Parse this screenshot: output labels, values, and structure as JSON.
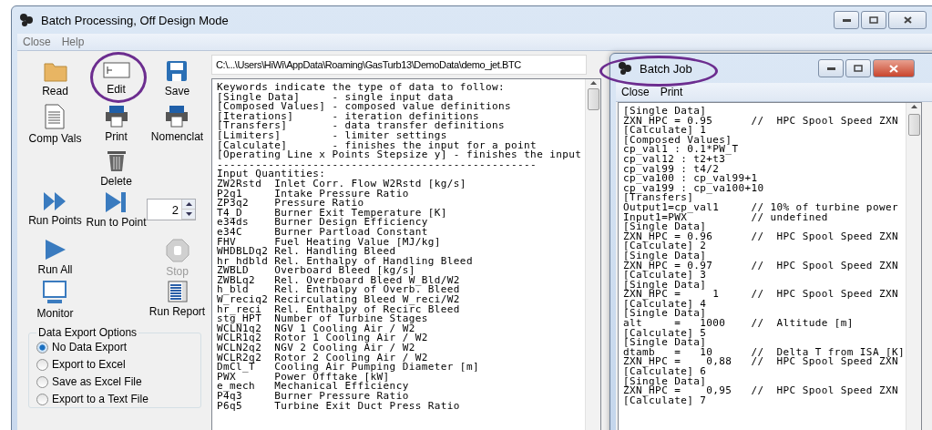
{
  "main_window": {
    "title": "Batch Processing, Off Design Mode",
    "menu": [
      "Close",
      "Help"
    ]
  },
  "toolbar": {
    "rows": [
      [
        {
          "kind": "button",
          "label": "Read",
          "highlighted": false,
          "disabled": false
        },
        {
          "kind": "button",
          "label": "Edit",
          "highlighted": true,
          "disabled": false
        },
        {
          "kind": "button",
          "label": "Save",
          "highlighted": false,
          "disabled": false
        }
      ],
      [
        {
          "kind": "button",
          "label": "Comp Vals",
          "highlighted": false,
          "disabled": false
        },
        {
          "kind": "button",
          "label": "Print",
          "highlighted": false,
          "disabled": false
        },
        {
          "kind": "button",
          "label": "Nomenclat",
          "highlighted": false,
          "disabled": false
        }
      ],
      [
        {
          "kind": "spacer"
        },
        {
          "kind": "button",
          "label": "Delete",
          "highlighted": false,
          "disabled": false
        },
        {
          "kind": "spacer"
        }
      ],
      [
        {
          "kind": "button",
          "label": "Run Points",
          "highlighted": false,
          "disabled": false
        },
        {
          "kind": "button",
          "label": "Run to Point",
          "highlighted": false,
          "disabled": false
        },
        {
          "kind": "spinner",
          "value": "2"
        }
      ],
      [
        {
          "kind": "button",
          "label": "Run All",
          "highlighted": false,
          "disabled": false
        },
        {
          "kind": "spacer"
        },
        {
          "kind": "button",
          "label": "Stop",
          "highlighted": false,
          "disabled": true
        }
      ],
      [
        {
          "kind": "button",
          "label": "Monitor",
          "highlighted": false,
          "disabled": false
        },
        {
          "kind": "spacer"
        },
        {
          "kind": "button",
          "label": "Run Report",
          "highlighted": false,
          "disabled": false
        }
      ]
    ]
  },
  "export_options": {
    "title": "Data Export Options",
    "options": [
      {
        "label": "No Data Export",
        "selected": true
      },
      {
        "label": "Export to Excel",
        "selected": false
      },
      {
        "label": "Save as Excel File",
        "selected": false
      },
      {
        "label": "Export to a Text File",
        "selected": false
      }
    ]
  },
  "file_path": "C:\\...\\Users\\HiWi\\AppData\\Roaming\\GasTurb13\\DemoData\\demo_jet.BTC",
  "editor_lines": [
    "Keywords indicate the type of data to follow:",
    "[Single Data]     - single input data",
    "[Composed Values] - composed value definitions",
    "[Iterations]      - iteration definitions",
    "[Transfers]       - data transfer definitions",
    "[Limiters]        - limiter settings",
    "[Calculate]       - finishes the input for a point",
    "[Operating Line x Points Stepsize y] - finishes the input",
    "--------------------------------------------------",
    "Input Quantities:",
    "ZW2Rstd  Inlet Corr. Flow W2Rstd [kg/s]",
    "P2q1     Intake Pressure Ratio",
    "ZP3q2    Pressure Ratio",
    "T4_D     Burner Exit Temperature [K]",
    "e34ds    Burner Design Efficiency",
    "e34C     Burner Partload Constant",
    "FHV      Fuel Heating Value [MJ/kg]",
    "WHDBLDq2 Rel. Handling Bleed",
    "hr_hdbld Rel. Enthalpy of Handling Bleed",
    "ZWBLD    Overboard Bleed [kg/s]",
    "ZWBLq2   Rel. Overboard Bleed W_Bld/W2",
    "h_bld    Rel. Enthalpy of Overb. Bleed",
    "W_reciq2 Recirculating Bleed W_reci/W2",
    "hr_reci  Rel. Enthalpy of Recirc Bleed",
    "stg_HPT  Number of Turbine Stages",
    "WCLN1q2  NGV 1 Cooling Air / W2",
    "WCLR1q2  Rotor 1 Cooling Air / W2",
    "WCLN2q2  NGV 2 Cooling Air / W2",
    "WCLR2q2  Rotor 2 Cooling Air / W2",
    "DmCl_T   Cooling Air Pumping Diameter [m]",
    "PWX      Power Offtake [kW]",
    "e_mech   Mechanical Efficiency",
    "P4q3     Burner Pressure Ratio",
    "P6q5     Turbine Exit Duct Press Ratio"
  ],
  "batch_window": {
    "title": "Batch Job",
    "title_highlighted": true,
    "menu": [
      "Close",
      "Print"
    ],
    "lines": [
      "[Single Data]",
      "ZXN_HPC = 0.95      //  HPC Spool Speed ZXN",
      "[Calculate] 1",
      "[Composed Values]",
      "cp_val1 : 0.1*PW_T",
      "cp_val12 : t2+t3",
      "cp_val99 : t4/2",
      "cp_va100 : cp_val99+1",
      "cp_va199 : cp_va100+10",
      "[Transfers]",
      "Output1=cp_val1     // 10% of turbine power",
      "Input1=PWX          // undefined",
      "[Single Data]",
      "ZXN_HPC = 0.96      //  HPC Spool Speed ZXN",
      "[Calculate] 2",
      "[Single Data]",
      "ZXN_HPC = 0.97      //  HPC Spool Speed ZXN",
      "[Calculate] 3",
      "[Single Data]",
      "ZXN_HPC =     1     //  HPC Spool Speed ZXN",
      "[Calculate] 4",
      "[Single Data]",
      "alt     =   1000    //  Altitude [m]",
      "[Calculate] 5",
      "[Single Data]",
      "dtamb   =   10      //  Delta T from ISA [K]",
      "ZXN_HPC =    0,88   //  HPC Spool Speed ZXN",
      "[Calculate] 6",
      "[Single Data]",
      "ZXN_HPC =    0,95   //  HPC Spool Speed ZXN",
      "[Calculate] 7"
    ]
  }
}
